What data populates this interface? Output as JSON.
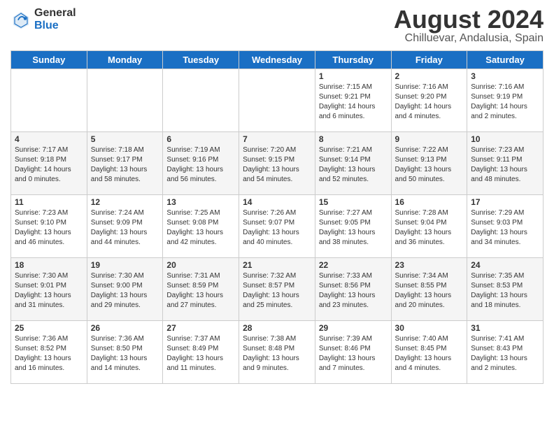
{
  "logo": {
    "general": "General",
    "blue": "Blue"
  },
  "header": {
    "month_year": "August 2024",
    "location": "Chilluevar, Andalusia, Spain"
  },
  "days_of_week": [
    "Sunday",
    "Monday",
    "Tuesday",
    "Wednesday",
    "Thursday",
    "Friday",
    "Saturday"
  ],
  "weeks": [
    [
      {
        "day": "",
        "info": ""
      },
      {
        "day": "",
        "info": ""
      },
      {
        "day": "",
        "info": ""
      },
      {
        "day": "",
        "info": ""
      },
      {
        "day": "1",
        "info": "Sunrise: 7:15 AM\nSunset: 9:21 PM\nDaylight: 14 hours\nand 6 minutes."
      },
      {
        "day": "2",
        "info": "Sunrise: 7:16 AM\nSunset: 9:20 PM\nDaylight: 14 hours\nand 4 minutes."
      },
      {
        "day": "3",
        "info": "Sunrise: 7:16 AM\nSunset: 9:19 PM\nDaylight: 14 hours\nand 2 minutes."
      }
    ],
    [
      {
        "day": "4",
        "info": "Sunrise: 7:17 AM\nSunset: 9:18 PM\nDaylight: 14 hours\nand 0 minutes."
      },
      {
        "day": "5",
        "info": "Sunrise: 7:18 AM\nSunset: 9:17 PM\nDaylight: 13 hours\nand 58 minutes."
      },
      {
        "day": "6",
        "info": "Sunrise: 7:19 AM\nSunset: 9:16 PM\nDaylight: 13 hours\nand 56 minutes."
      },
      {
        "day": "7",
        "info": "Sunrise: 7:20 AM\nSunset: 9:15 PM\nDaylight: 13 hours\nand 54 minutes."
      },
      {
        "day": "8",
        "info": "Sunrise: 7:21 AM\nSunset: 9:14 PM\nDaylight: 13 hours\nand 52 minutes."
      },
      {
        "day": "9",
        "info": "Sunrise: 7:22 AM\nSunset: 9:13 PM\nDaylight: 13 hours\nand 50 minutes."
      },
      {
        "day": "10",
        "info": "Sunrise: 7:23 AM\nSunset: 9:11 PM\nDaylight: 13 hours\nand 48 minutes."
      }
    ],
    [
      {
        "day": "11",
        "info": "Sunrise: 7:23 AM\nSunset: 9:10 PM\nDaylight: 13 hours\nand 46 minutes."
      },
      {
        "day": "12",
        "info": "Sunrise: 7:24 AM\nSunset: 9:09 PM\nDaylight: 13 hours\nand 44 minutes."
      },
      {
        "day": "13",
        "info": "Sunrise: 7:25 AM\nSunset: 9:08 PM\nDaylight: 13 hours\nand 42 minutes."
      },
      {
        "day": "14",
        "info": "Sunrise: 7:26 AM\nSunset: 9:07 PM\nDaylight: 13 hours\nand 40 minutes."
      },
      {
        "day": "15",
        "info": "Sunrise: 7:27 AM\nSunset: 9:05 PM\nDaylight: 13 hours\nand 38 minutes."
      },
      {
        "day": "16",
        "info": "Sunrise: 7:28 AM\nSunset: 9:04 PM\nDaylight: 13 hours\nand 36 minutes."
      },
      {
        "day": "17",
        "info": "Sunrise: 7:29 AM\nSunset: 9:03 PM\nDaylight: 13 hours\nand 34 minutes."
      }
    ],
    [
      {
        "day": "18",
        "info": "Sunrise: 7:30 AM\nSunset: 9:01 PM\nDaylight: 13 hours\nand 31 minutes."
      },
      {
        "day": "19",
        "info": "Sunrise: 7:30 AM\nSunset: 9:00 PM\nDaylight: 13 hours\nand 29 minutes."
      },
      {
        "day": "20",
        "info": "Sunrise: 7:31 AM\nSunset: 8:59 PM\nDaylight: 13 hours\nand 27 minutes."
      },
      {
        "day": "21",
        "info": "Sunrise: 7:32 AM\nSunset: 8:57 PM\nDaylight: 13 hours\nand 25 minutes."
      },
      {
        "day": "22",
        "info": "Sunrise: 7:33 AM\nSunset: 8:56 PM\nDaylight: 13 hours\nand 23 minutes."
      },
      {
        "day": "23",
        "info": "Sunrise: 7:34 AM\nSunset: 8:55 PM\nDaylight: 13 hours\nand 20 minutes."
      },
      {
        "day": "24",
        "info": "Sunrise: 7:35 AM\nSunset: 8:53 PM\nDaylight: 13 hours\nand 18 minutes."
      }
    ],
    [
      {
        "day": "25",
        "info": "Sunrise: 7:36 AM\nSunset: 8:52 PM\nDaylight: 13 hours\nand 16 minutes."
      },
      {
        "day": "26",
        "info": "Sunrise: 7:36 AM\nSunset: 8:50 PM\nDaylight: 13 hours\nand 14 minutes."
      },
      {
        "day": "27",
        "info": "Sunrise: 7:37 AM\nSunset: 8:49 PM\nDaylight: 13 hours\nand 11 minutes."
      },
      {
        "day": "28",
        "info": "Sunrise: 7:38 AM\nSunset: 8:48 PM\nDaylight: 13 hours\nand 9 minutes."
      },
      {
        "day": "29",
        "info": "Sunrise: 7:39 AM\nSunset: 8:46 PM\nDaylight: 13 hours\nand 7 minutes."
      },
      {
        "day": "30",
        "info": "Sunrise: 7:40 AM\nSunset: 8:45 PM\nDaylight: 13 hours\nand 4 minutes."
      },
      {
        "day": "31",
        "info": "Sunrise: 7:41 AM\nSunset: 8:43 PM\nDaylight: 13 hours\nand 2 minutes."
      }
    ]
  ]
}
